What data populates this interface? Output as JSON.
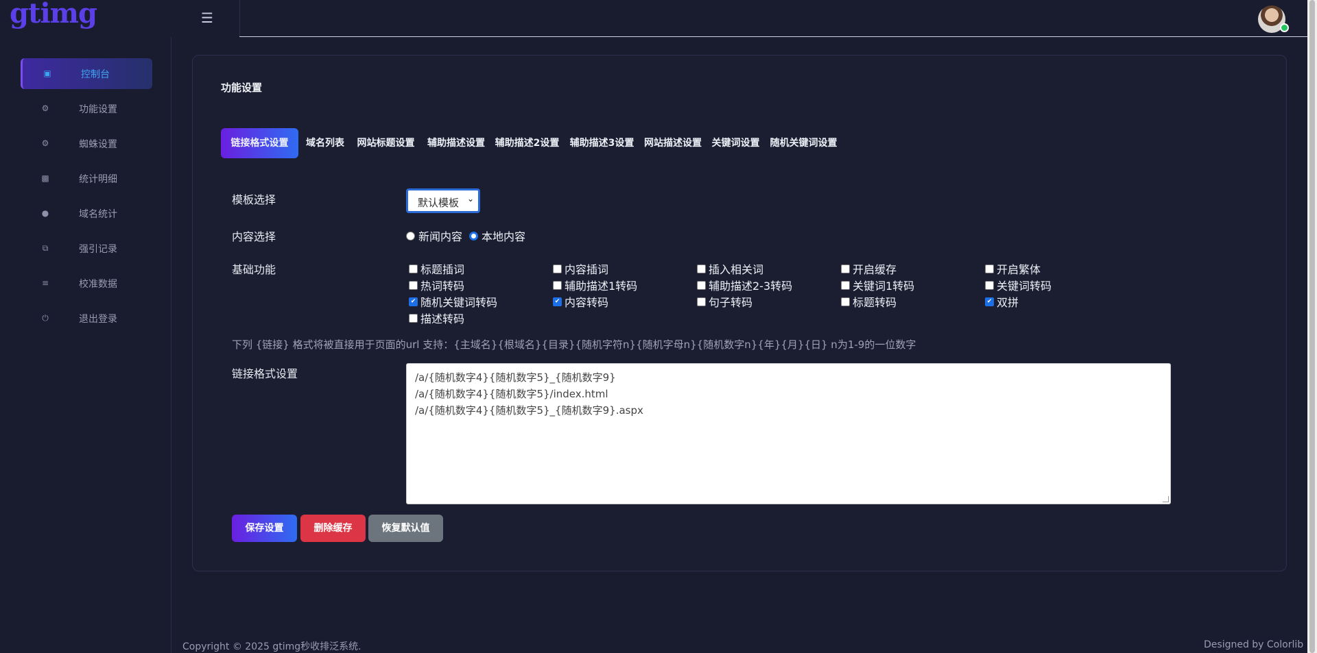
{
  "app": {
    "logo": "gtimg"
  },
  "header": {
    "menu_icon": "hamburger-icon",
    "avatar_status_color": "#22c55e"
  },
  "sidebar": {
    "items": [
      {
        "label": "控制台",
        "icon": "laptop-icon",
        "active": true
      },
      {
        "label": "功能设置",
        "icon": "cogs-icon"
      },
      {
        "label": "蜘蛛设置",
        "icon": "cogs-icon"
      },
      {
        "label": "统计明细",
        "icon": "bar-chart-icon"
      },
      {
        "label": "域名统计",
        "icon": "globe-icon"
      },
      {
        "label": "强引记录",
        "icon": "copy-icon"
      },
      {
        "label": "校准数据",
        "icon": "list-icon"
      },
      {
        "label": "退出登录",
        "icon": "power-icon"
      }
    ]
  },
  "main": {
    "title": "功能设置",
    "tabs": [
      {
        "label": "链接格式设置",
        "active": true
      },
      {
        "label": "域名列表"
      },
      {
        "label": "网站标题设置"
      },
      {
        "label": "辅助描述设置"
      },
      {
        "label": "辅助描述2设置"
      },
      {
        "label": "辅助描述3设置"
      },
      {
        "label": "网站描述设置"
      },
      {
        "label": "关键词设置"
      },
      {
        "label": "随机关键词设置"
      }
    ],
    "template": {
      "label": "模板选择",
      "selected": "默认模板"
    },
    "content": {
      "label": "内容选择",
      "options": [
        {
          "label": "新闻内容",
          "checked": false
        },
        {
          "label": "本地内容",
          "checked": true
        }
      ]
    },
    "features": {
      "label": "基础功能",
      "options": [
        {
          "label": "标题插词",
          "checked": false
        },
        {
          "label": "内容插词",
          "checked": false
        },
        {
          "label": "插入相关词",
          "checked": false
        },
        {
          "label": "开启缓存",
          "checked": false
        },
        {
          "label": "开启繁体",
          "checked": false
        },
        {
          "label": "热词转码",
          "checked": false
        },
        {
          "label": "辅助描述1转码",
          "checked": false
        },
        {
          "label": "辅助描述2-3转码",
          "checked": false
        },
        {
          "label": "关键词1转码",
          "checked": false
        },
        {
          "label": "关键词转码",
          "checked": false
        },
        {
          "label": "随机关键词转码",
          "checked": true
        },
        {
          "label": "内容转码",
          "checked": true
        },
        {
          "label": "句子转码",
          "checked": false
        },
        {
          "label": "标题转码",
          "checked": false
        },
        {
          "label": "双拼",
          "checked": true
        },
        {
          "label": "描述转码",
          "checked": false
        }
      ]
    },
    "hint": "下列 {链接} 格式将被直接用于页面的url 支持：{主域名}{根域名}{目录}{随机字符n}{随机字母n}{随机数字n}{年}{月}{日} n为1-9的一位数字",
    "link_format": {
      "label": "链接格式设置",
      "lines": [
        "/a/{随机数字4}{随机数字5}_{随机数字9}",
        "/a/{随机数字4}{随机数字5}/index.html",
        "/a/{随机数字4}{随机数字5}_{随机数字9}.aspx"
      ]
    },
    "buttons": {
      "save": "保存设置",
      "delete_cache": "删除缓存",
      "reset": "恢复默认值"
    }
  },
  "footer": {
    "copyright": "Copyright © 2025 gtimg秒收排泛系统.",
    "designed_by": "Designed by Colorlib"
  },
  "colors": {
    "accent": "#3da5f4",
    "primary_gradient_start": "#6a1fe0",
    "primary_gradient_end": "#2f6cf2",
    "danger": "#dc3545",
    "secondary": "#6c757d"
  }
}
